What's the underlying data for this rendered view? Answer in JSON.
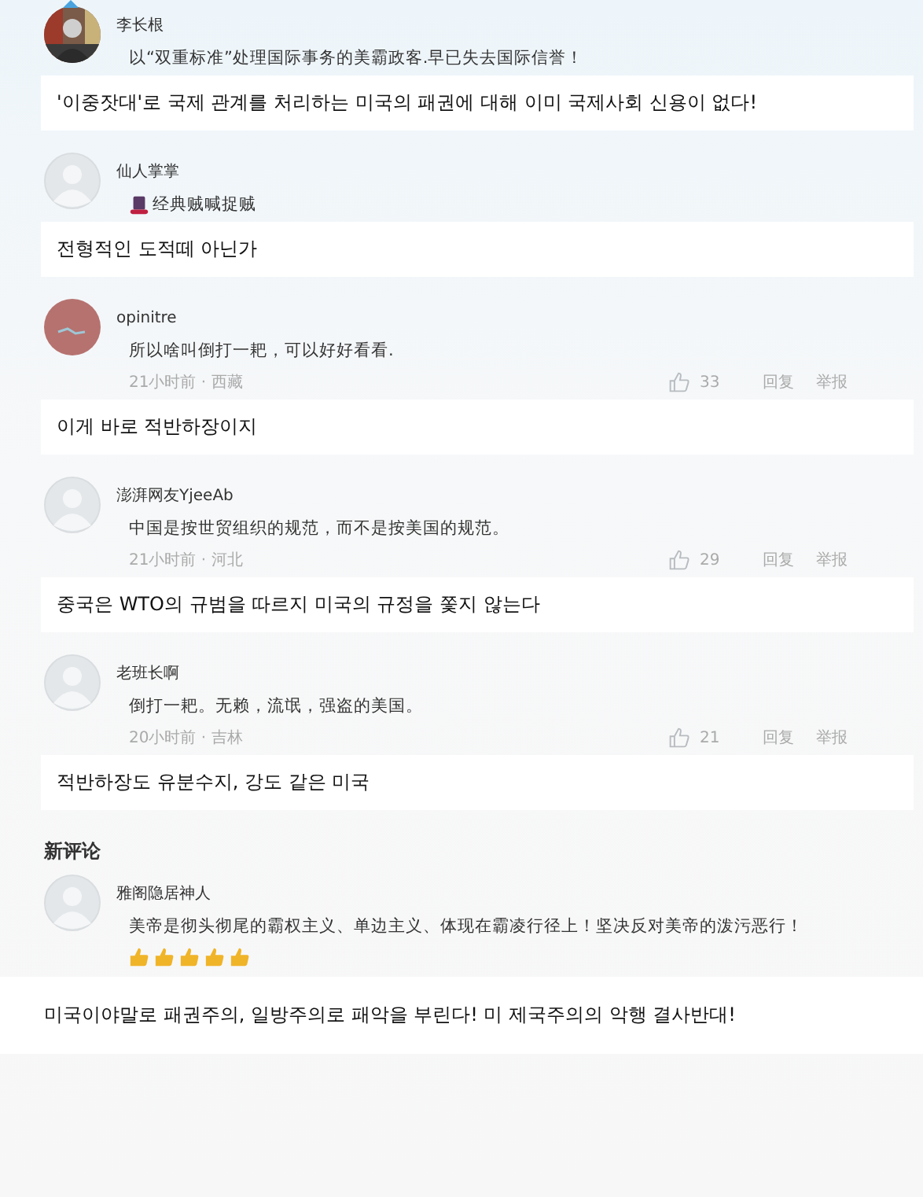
{
  "comments": [
    {
      "author": "李长根",
      "text": "以“双重标准”处理国际事务的美霸政客.早已失去国际信誉！",
      "translation": "'이중잣대'로 국제 관계를 처리하는 미국의 패권에 대해 이미 국제사회 신용이 없다!"
    },
    {
      "author": "仙人掌掌",
      "avatar": {
        "kind": "default"
      },
      "lead_icon": {
        "kind": "hat"
      },
      "text": "经典贼喊捉贼",
      "translation": "전형적인 도적떼 아닌가"
    },
    {
      "author": "opinitre",
      "avatar": {
        "kind": "pink"
      },
      "text": "所以啥叫倒打一耙，可以好好看看.",
      "meta": {
        "time": "21小时前 · 西藏",
        "likes": "33",
        "reply": "回复",
        "report": "举报"
      },
      "translation": "이게 바로 적반하장이지"
    },
    {
      "author": "澎湃网友YjeeAb",
      "avatar": {
        "kind": "default"
      },
      "text": "中国是按世贸组织的规范，而不是按美国的规范。",
      "meta": {
        "time": "21小时前 · 河北",
        "likes": "29",
        "reply": "回复",
        "report": "举报"
      },
      "translation": "중국은 WTO의 규범을 따르지 미국의 규정을 쫓지 않는다"
    },
    {
      "author": "老班长啊",
      "avatar": {
        "kind": "default"
      },
      "text": "倒打一耙。无赖，流氓，强盗的美国。",
      "meta": {
        "time": "20小时前 · 吉林",
        "likes": "21",
        "reply": "回复",
        "report": "举报"
      },
      "translation": "적반하장도 유분수지, 강도 같은 미국"
    }
  ],
  "section_title": "新评论",
  "new_comment": {
    "author": "雅阁隐居神人",
    "avatar": {
      "kind": "default"
    },
    "text": "美帝是彻头彻尾的霸权主义、单边主义、体现在霸凌行径上！坚决反对美帝的泼污恶行！",
    "reactions": [
      {
        "kind": "thumbs-up"
      },
      {
        "kind": "thumbs-up"
      },
      {
        "kind": "thumbs-up"
      },
      {
        "kind": "thumbs-up"
      },
      {
        "kind": "thumbs-up"
      }
    ],
    "translation": "미국이야말로 패권주의, 일방주의로 패악을 부린다! 미 제국주의의 악행 결사반대!"
  }
}
